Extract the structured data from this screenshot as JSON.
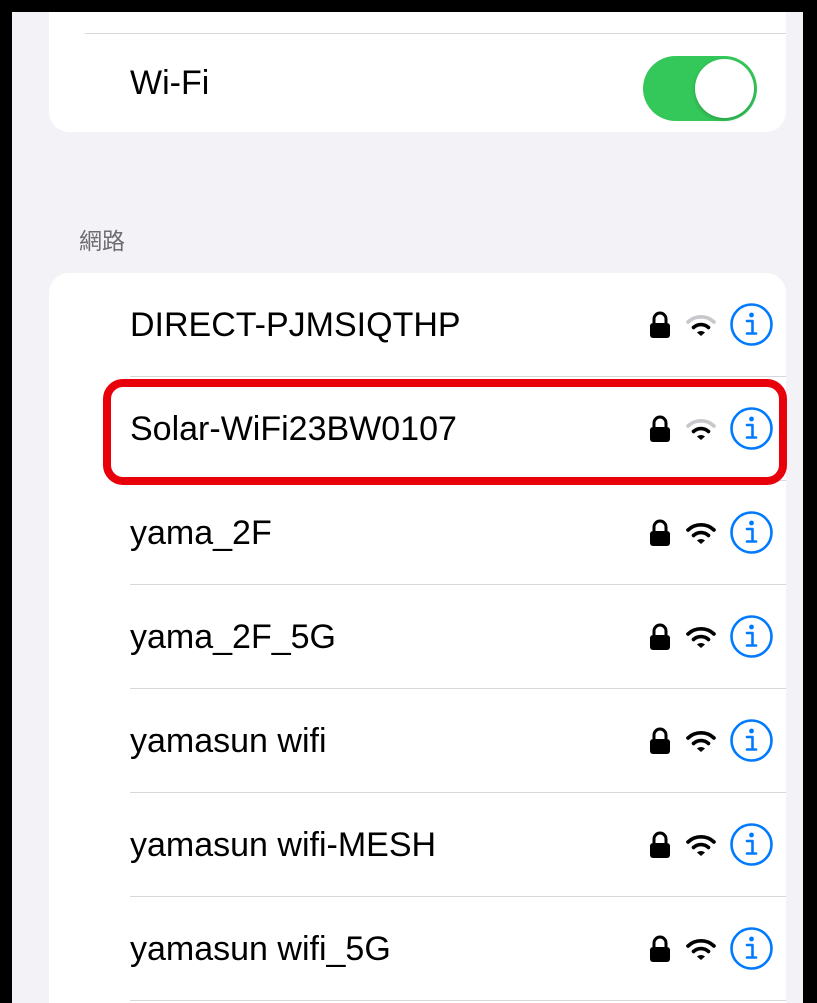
{
  "wifi": {
    "label": "Wi-Fi",
    "enabled": true,
    "toggle_color": "#34c759"
  },
  "section_header": "網路",
  "networks": [
    {
      "name": "DIRECT-PJMSIQTHP",
      "secured": true,
      "signal": "weak",
      "icon_lock": "lock-icon",
      "icon_signal": "wifi-signal-icon",
      "icon_info": "info-icon"
    },
    {
      "name": "Solar-WiFi23BW0107",
      "secured": true,
      "signal": "weak",
      "icon_lock": "lock-icon",
      "icon_signal": "wifi-signal-icon",
      "icon_info": "info-icon"
    },
    {
      "name": "yama_2F",
      "secured": true,
      "signal": "full",
      "icon_lock": "lock-icon",
      "icon_signal": "wifi-signal-icon",
      "icon_info": "info-icon"
    },
    {
      "name": "yama_2F_5G",
      "secured": true,
      "signal": "full",
      "icon_lock": "lock-icon",
      "icon_signal": "wifi-signal-icon",
      "icon_info": "info-icon"
    },
    {
      "name": "yamasun wifi",
      "secured": true,
      "signal": "full",
      "icon_lock": "lock-icon",
      "icon_signal": "wifi-signal-icon",
      "icon_info": "info-icon"
    },
    {
      "name": "yamasun wifi-MESH",
      "secured": true,
      "signal": "full",
      "icon_lock": "lock-icon",
      "icon_signal": "wifi-signal-icon",
      "icon_info": "info-icon"
    },
    {
      "name": "yamasun wifi_5G",
      "secured": true,
      "signal": "full",
      "icon_lock": "lock-icon",
      "icon_signal": "wifi-signal-icon",
      "icon_info": "info-icon"
    }
  ],
  "highlighted_network": "Solar-WiFi23BW0107",
  "colors": {
    "accent": "#007aff",
    "highlight": "#e8000b",
    "background": "#f2f2f7",
    "card": "#ffffff"
  }
}
